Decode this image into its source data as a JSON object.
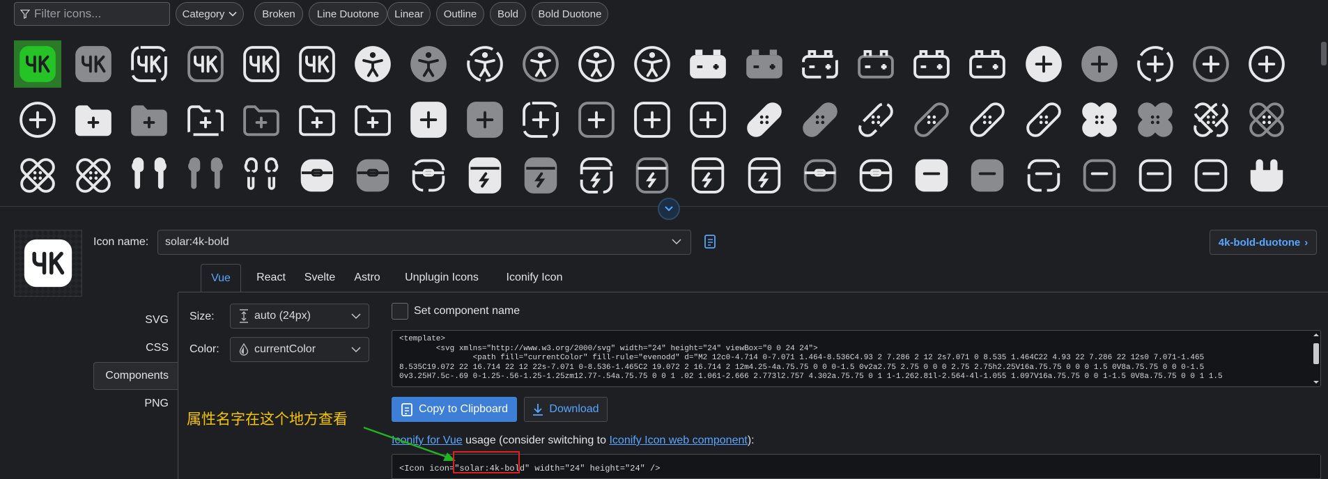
{
  "filter": {
    "placeholder": "Filter icons..."
  },
  "chips": [
    {
      "label": "Category",
      "has_dropdown": true
    },
    {
      "label": "Broken"
    },
    {
      "label": "Line Duotone"
    },
    {
      "label": "Linear"
    },
    {
      "label": "Outline"
    },
    {
      "label": "Bold"
    },
    {
      "label": "Bold Duotone"
    }
  ],
  "icon_grid": {
    "selected_index": 0,
    "accent_color": "#25c325",
    "rows": [
      [
        "4k-bold",
        "4k-bold-duotone",
        "4k-broken",
        "4k-line-duotone",
        "4k-linear",
        "4k-outline",
        "accessibility-bold",
        "accessibility-bold-duotone",
        "accessibility-broken",
        "accessibility-line-duotone",
        "accessibility-linear",
        "accessibility-outline",
        "accumulator-bold",
        "accumulator-bold-duotone",
        "accumulator-broken",
        "accumulator-line-duotone",
        "accumulator-linear",
        "accumulator-outline",
        "add-circle-bold",
        "add-circle-bold-duotone",
        "add-circle-broken",
        "add-circle-line-duotone",
        "add-circle-linear"
      ],
      [
        "add-circle-outline",
        "add-folder-bold",
        "add-folder-bold-duotone",
        "add-folder-broken",
        "add-folder-line-duotone",
        "add-folder-linear",
        "add-folder-outline",
        "add-square-bold",
        "add-square-bold-duotone",
        "add-square-broken",
        "add-square-line-duotone",
        "add-square-linear",
        "add-square-outline",
        "adhesive-plaster-bold",
        "adhesive-plaster-bold-duotone",
        "adhesive-plaster-broken",
        "adhesive-plaster-line-duotone",
        "adhesive-plaster-linear",
        "adhesive-plaster-outline",
        "adhesive-plaster-2-bold",
        "adhesive-plaster-2-bold-duotone",
        "adhesive-plaster-2-broken",
        "adhesive-plaster-2-line-duotone"
      ],
      [
        "adhesive-plaster-2-linear",
        "adhesive-plaster-2-outline",
        "airbuds-bold",
        "airbuds-bold-duotone",
        "airbuds-broken",
        "airbuds-case-bold",
        "airbuds-case-bold-duotone",
        "airbuds-case-broken",
        "airbuds-case-charge-bold",
        "airbuds-case-charge-bold-duotone",
        "airbuds-case-charge-broken",
        "airbuds-case-charge-line-duotone",
        "airbuds-case-charge-linear",
        "airbuds-case-charge-outline",
        "airbuds-case-line-duotone",
        "airbuds-case-linear",
        "airbuds-case-minimalistic-bold",
        "airbuds-case-minimalistic-bold-duotone",
        "airbuds-case-minimalistic-broken",
        "airbuds-case-minimalistic-line-duotone",
        "airbuds-case-minimalistic-linear",
        "airbuds-case-minimalistic-outline",
        "airbuds-case-open-bold"
      ]
    ]
  },
  "details": {
    "icon_name_label": "Icon name:",
    "icon_name_value": "solar:4k-bold",
    "next_link": "4k-bold-duotone",
    "tabs": [
      "Vue",
      "React",
      "Svelte",
      "Astro",
      "Unplugin Icons",
      "Iconify Icon"
    ],
    "active_tab": "Vue",
    "side_nav": [
      "SVG",
      "CSS",
      "Components",
      "PNG"
    ],
    "active_side": "Components",
    "size_label": "Size:",
    "size_value": "auto (24px)",
    "color_label": "Color:",
    "color_value": "currentColor",
    "set_component_name": "Set component name",
    "code_lines": [
      "<template>",
      "        <svg xmlns=\"http://www.w3.org/2000/svg\" width=\"24\" height=\"24\" viewBox=\"0 0 24 24\">",
      "                <path fill=\"currentColor\" fill-rule=\"evenodd\" d=\"M2 12c0-4.714 0-7.071 1.464-8.536C4.93 2 7.286 2 12 2s7.071 0 8.535 1.464C22 4.93 22 7.286 22 12s0 7.071-1.465",
      "8.535C19.072 22 16.714 22 12 22s-7.071 0-8.536-1.465C2 19.072 2 16.714 2 12m4.25-4a.75.75 0 0 0-1.5 0v2a2.75 2.75 0 0 0 2.75 2.75h2.25V16a.75.75 0 0 0 1.5 0V8a.75.75 0 0 0-1.5",
      "0v3.25H7.5c-.69 0-1.25-.56-1.25-1.25zm12.77-.54a.75.75 0 0 1 .02 1.061-2.666 2.773l2.757 4.302a.75.75 0 1 1-1.262.81l-2.564-4l-1.055 1.097V16a.75.75 0 0 1-1.5 0V8a.75.75 0 0 1 1.5"
    ],
    "copy_button": "Copy to Clipboard",
    "download_button": "Download",
    "usage_link_1": "Iconify for Vue",
    "usage_text_1": " usage (consider switching to ",
    "usage_link_2": "Iconify Icon web component",
    "usage_text_2": "):",
    "usage_code": "<Icon icon=\"solar:4k-bold\" width=\"24\" height=\"24\" />"
  },
  "annotation": {
    "text": "属性名字在这个地方查看",
    "text_color": "#f5c400",
    "arrow_color": "#22b322",
    "box_color": "#e02020"
  }
}
